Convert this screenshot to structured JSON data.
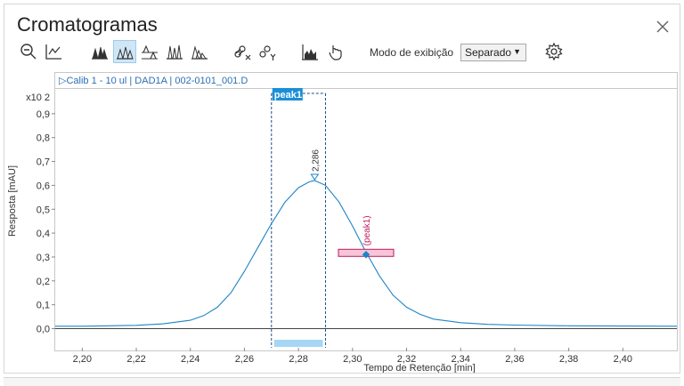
{
  "window": {
    "title": "Cromatogramas"
  },
  "toolbar": {
    "buttons": [
      {
        "icon": "zoom-out-icon"
      },
      {
        "icon": "axis-icon"
      },
      {
        "icon": "overlay-peaks-icon"
      },
      {
        "icon": "separate-peaks-icon",
        "active": true
      },
      {
        "icon": "stacked-peaks-icon"
      },
      {
        "icon": "offset-peaks-icon"
      },
      {
        "icon": "shifted-peaks-icon"
      },
      {
        "icon": "link-x-icon"
      },
      {
        "icon": "link-y-icon"
      },
      {
        "icon": "integration-icon"
      },
      {
        "icon": "manual-touch-icon"
      },
      {
        "icon": "settings-icon"
      }
    ],
    "mode_label": "Modo de exibição",
    "mode_value": "Separado"
  },
  "dataset": {
    "label": "▷Calib 1 - 10 ul | DAD1A | 002-0101_001.D"
  },
  "chart_data": {
    "type": "line",
    "xlabel": "Tempo de Retenção [min]",
    "ylabel": "Resposta [mAU]",
    "y_multiplier": "x10 2",
    "xlim": [
      2.19,
      2.42
    ],
    "ylim": [
      -0.08,
      1.0
    ],
    "x_ticks": [
      "2,20",
      "2,22",
      "2,24",
      "2,26",
      "2,28",
      "2,30",
      "2,32",
      "2,34",
      "2,36",
      "2,38",
      "2,40"
    ],
    "x_tick_values": [
      2.2,
      2.22,
      2.24,
      2.26,
      2.28,
      2.3,
      2.32,
      2.34,
      2.36,
      2.38,
      2.4
    ],
    "y_ticks": [
      "0,0",
      "0,1",
      "0,2",
      "0,3",
      "0,4",
      "0,5",
      "0,6",
      "0,7",
      "0,8",
      "0,9"
    ],
    "y_tick_values": [
      0.0,
      0.1,
      0.2,
      0.3,
      0.4,
      0.5,
      0.6,
      0.7,
      0.8,
      0.9
    ],
    "series": [
      {
        "x": [
          2.19,
          2.2,
          2.21,
          2.22,
          2.23,
          2.24,
          2.245,
          2.25,
          2.255,
          2.26,
          2.265,
          2.27,
          2.275,
          2.28,
          2.284,
          2.286,
          2.29,
          2.295,
          2.3,
          2.305,
          2.31,
          2.315,
          2.32,
          2.325,
          2.33,
          2.34,
          2.35,
          2.36,
          2.38,
          2.4,
          2.42
        ],
        "y": [
          0.01,
          0.01,
          0.012,
          0.014,
          0.02,
          0.035,
          0.055,
          0.09,
          0.15,
          0.24,
          0.34,
          0.44,
          0.53,
          0.59,
          0.615,
          0.62,
          0.6,
          0.53,
          0.43,
          0.32,
          0.22,
          0.14,
          0.09,
          0.06,
          0.04,
          0.025,
          0.018,
          0.015,
          0.012,
          0.011,
          0.01
        ]
      }
    ],
    "peak": {
      "label": "peak1",
      "start": 2.27,
      "end": 2.29,
      "apex_x": 2.286,
      "apex_y": 0.62,
      "apex_label": "2,286"
    },
    "marker": {
      "label": "(peak1)",
      "x": 2.305,
      "y": 0.31
    }
  }
}
